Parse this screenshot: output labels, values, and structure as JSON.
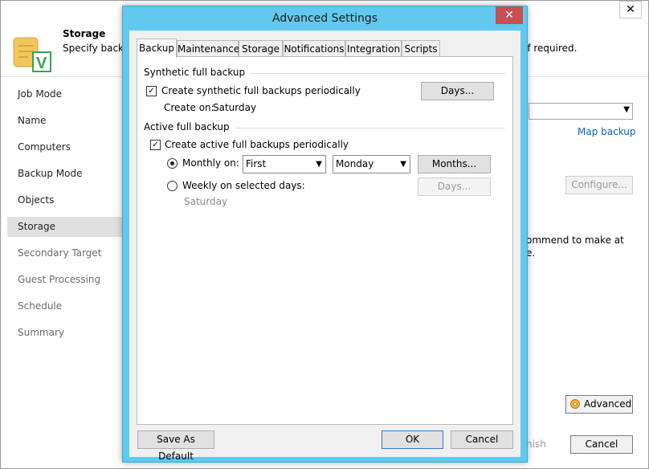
{
  "wizard": {
    "close_glyph": "✕",
    "header": {
      "title": "Storage",
      "description": "Specify backu",
      "description_tail": "if required."
    },
    "sidebar": {
      "items": [
        {
          "label": "Job Mode"
        },
        {
          "label": "Name"
        },
        {
          "label": "Computers"
        },
        {
          "label": "Backup Mode"
        },
        {
          "label": "Objects"
        },
        {
          "label": "Storage",
          "selected": true
        },
        {
          "label": "Secondary Target"
        },
        {
          "label": "Guest Processing"
        },
        {
          "label": "Schedule"
        },
        {
          "label": "Summary"
        }
      ]
    },
    "map_backup_link": "Map backup",
    "configure_button": "Configure...",
    "recommend_line1": "ommend to make at",
    "recommend_line2": "e.",
    "advanced_button": "Advanced",
    "finish_button": "nish",
    "cancel_button": "Cancel"
  },
  "dialog": {
    "title": "Advanced Settings",
    "close_glyph": "✕",
    "tabs": [
      "Backup",
      "Maintenance",
      "Storage",
      "Notifications",
      "Integration",
      "Scripts"
    ],
    "active_tab": "Backup",
    "synthetic": {
      "group_label": "Synthetic full backup",
      "checkbox_label": "Create synthetic full backups periodically",
      "checked": true,
      "create_on_label": "Create on:",
      "create_on_value": "Saturday",
      "days_button": "Days..."
    },
    "active": {
      "group_label": "Active full backup",
      "checkbox_label": "Create active full backups periodically",
      "checked": true,
      "monthly_label": "Monthly on:",
      "monthly_selected": true,
      "monthly_week_value": "First",
      "monthly_day_value": "Monday",
      "months_button": "Months...",
      "weekly_label": "Weekly on selected days:",
      "weekly_days_value": "Saturday",
      "days_button": "Days..."
    },
    "save_default_button": "Save As Default",
    "ok_button": "OK",
    "cancel_button": "Cancel"
  },
  "colors": {
    "dialog_frame": "#62c9ee",
    "close_button": "#c75050",
    "link": "#0a63b8",
    "sidebar_selected": "#e0e0e0"
  }
}
